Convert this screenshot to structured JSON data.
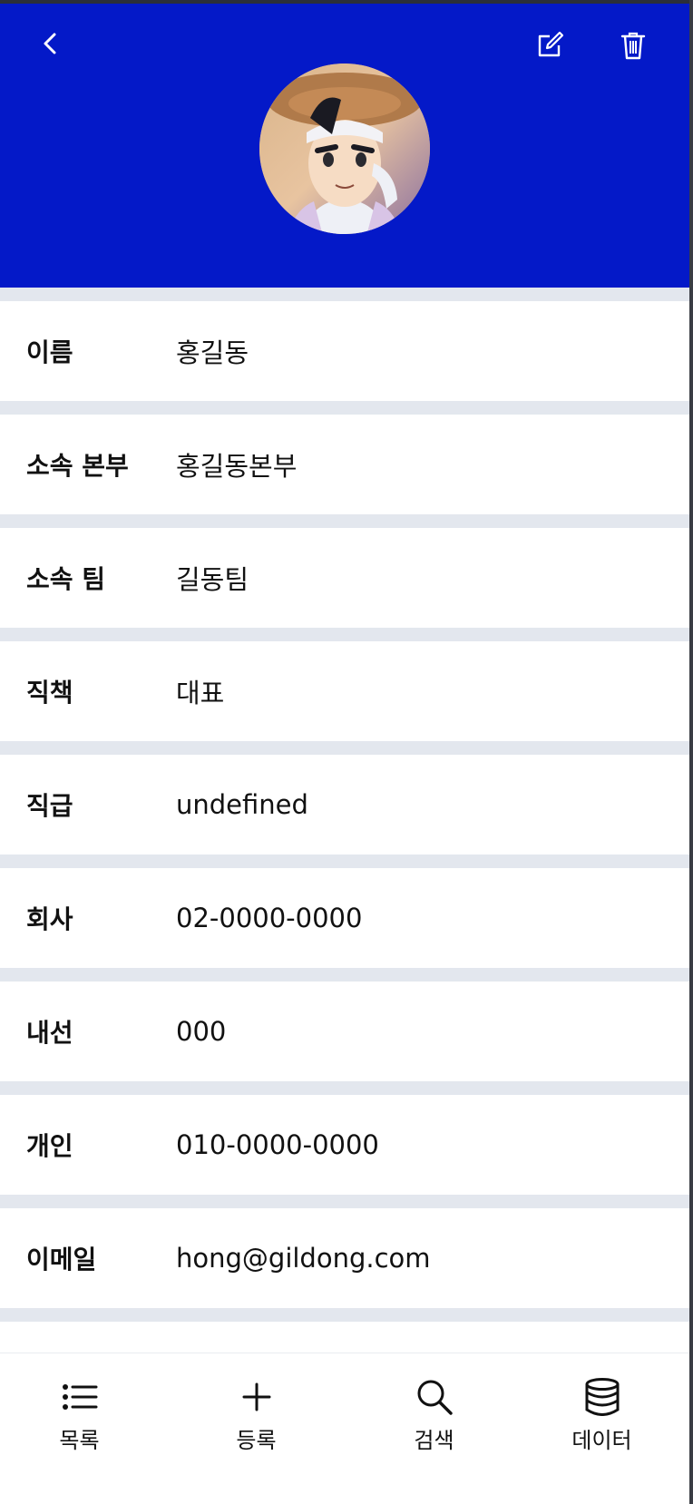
{
  "header": {
    "bg_color": "#0419c8",
    "back_icon": "chevron-left-icon",
    "edit_icon": "edit-icon",
    "delete_icon": "trash-icon",
    "avatar": "profile-avatar"
  },
  "profile": {
    "rows": [
      {
        "label": "이름",
        "value": "홍길동"
      },
      {
        "label": "소속 본부",
        "value": "홍길동본부"
      },
      {
        "label": "소속 팀",
        "value": "길동팀"
      },
      {
        "label": "직책",
        "value": "대표"
      },
      {
        "label": "직급",
        "value": "undefined"
      },
      {
        "label": "회사",
        "value": "02-0000-0000"
      },
      {
        "label": "내선",
        "value": "000"
      },
      {
        "label": "개인",
        "value": "010-0000-0000"
      },
      {
        "label": "이메일",
        "value": "hong@gildong.com"
      }
    ]
  },
  "nav": {
    "items": [
      {
        "label": "목록",
        "icon": "list-icon"
      },
      {
        "label": "등록",
        "icon": "plus-icon"
      },
      {
        "label": "검색",
        "icon": "search-icon"
      },
      {
        "label": "데이터",
        "icon": "database-icon"
      }
    ]
  }
}
